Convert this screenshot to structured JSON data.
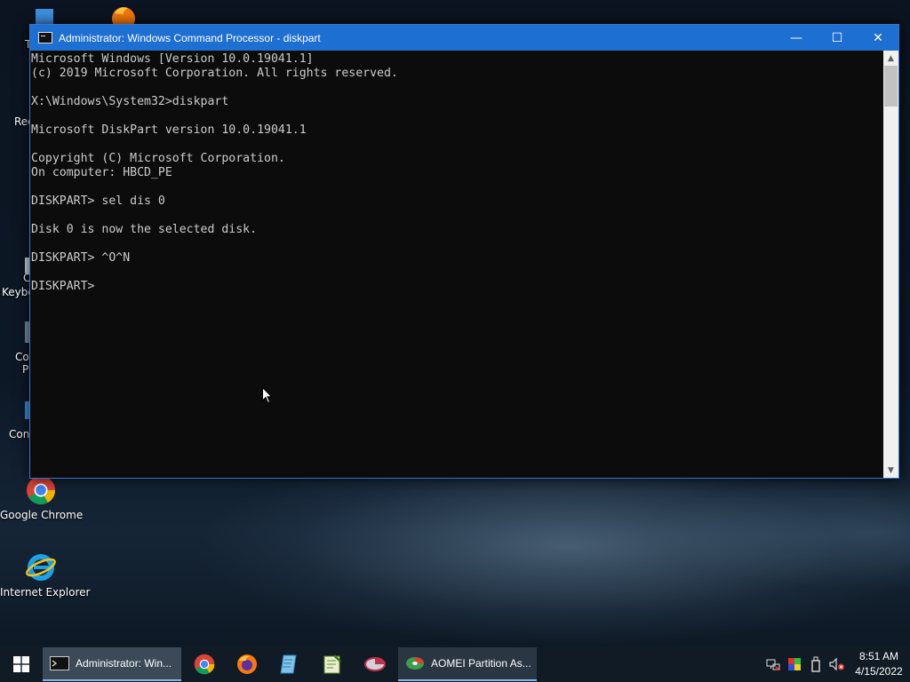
{
  "desktop": {
    "icons": [
      {
        "name": "Google Chrome"
      },
      {
        "name": "Internet Explorer"
      }
    ],
    "partial_labels": [
      "T",
      "Rec",
      "C",
      "Keybo",
      "Co",
      "P",
      "Con"
    ]
  },
  "cmd_window": {
    "title": "Administrator: Windows Command Processor - diskpart",
    "buttons": {
      "minimize": "—",
      "maximize": "☐",
      "close": "✕"
    },
    "console_text": "Microsoft Windows [Version 10.0.19041.1]\n(c) 2019 Microsoft Corporation. All rights reserved.\n\nX:\\Windows\\System32>diskpart\n\nMicrosoft DiskPart version 10.0.19041.1\n\nCopyright (C) Microsoft Corporation.\nOn computer: HBCD_PE\n\nDISKPART> sel dis 0\n\nDisk 0 is now the selected disk.\n\nDISKPART> ^O^N\n\nDISKPART> ",
    "scroll_arrows": {
      "up": "▲",
      "down": "▼"
    }
  },
  "taskbar": {
    "items": [
      {
        "label": "Administrator: Win...",
        "state": "active"
      },
      {
        "label": "AOMEI Partition As...",
        "state": "open"
      }
    ],
    "pinned": [
      "chrome-icon",
      "firefox-icon",
      "notepad-icon",
      "notepadpp-icon",
      "partition-tool-icon"
    ],
    "tray_icons": [
      "network-icon",
      "color-tool-icon",
      "usb-icon",
      "volume-muted-icon"
    ],
    "clock": {
      "time": "8:51 AM",
      "date": "4/15/2022"
    }
  },
  "colors": {
    "titlebar": "#1e6fd2",
    "console_bg": "#0c0c0c",
    "console_fg": "#cccccc",
    "taskbar": "#101b25"
  }
}
